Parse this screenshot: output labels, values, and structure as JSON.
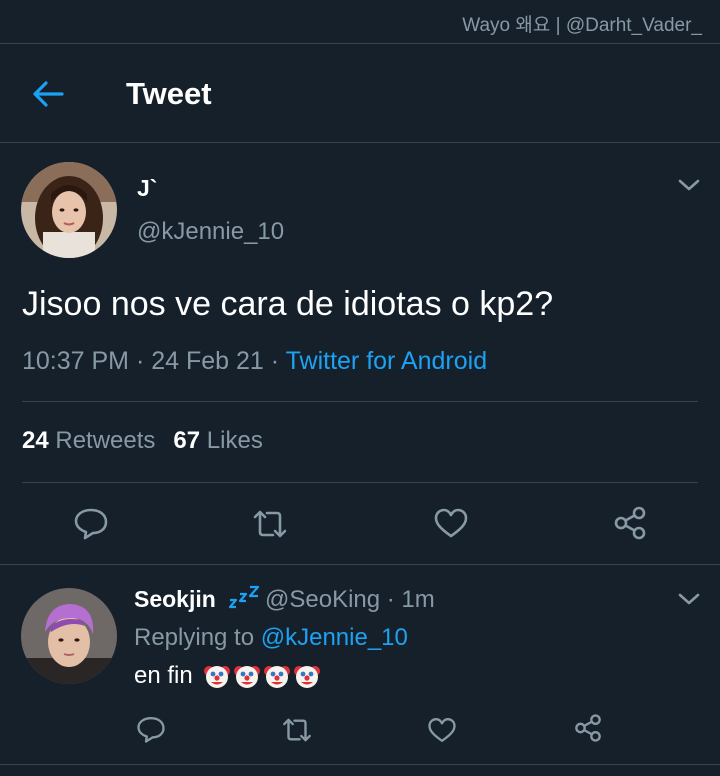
{
  "watermark": "Wayo 왜요 | @Darht_Vader_",
  "header": {
    "title": "Tweet"
  },
  "tweet": {
    "author_name": "J`",
    "author_handle": "@kJennie_10",
    "text": "Jisoo nos ve cara de idiotas o kp2?",
    "time": "10:37 PM",
    "separator": "·",
    "date": "24 Feb 21",
    "source": "Twitter for Android",
    "retweets_count": "24",
    "retweets_label": "Retweets",
    "likes_count": "67",
    "likes_label": "Likes"
  },
  "reply": {
    "author_name": "Seokjin",
    "author_handle_and_time": "@SeoKing · 1m",
    "replying_prefix": "Replying to",
    "replying_handle": "@kJennie_10",
    "text": "en fin"
  },
  "icons": [
    "back-arrow-icon",
    "chevron-down-icon",
    "reply-icon",
    "retweet-icon",
    "like-icon",
    "share-icon",
    "zzz-emoji",
    "clown-emoji"
  ],
  "colors": {
    "background": "#15202b",
    "accent": "#1da1f2",
    "secondary_text": "#8899a6",
    "divider": "#38444d"
  }
}
